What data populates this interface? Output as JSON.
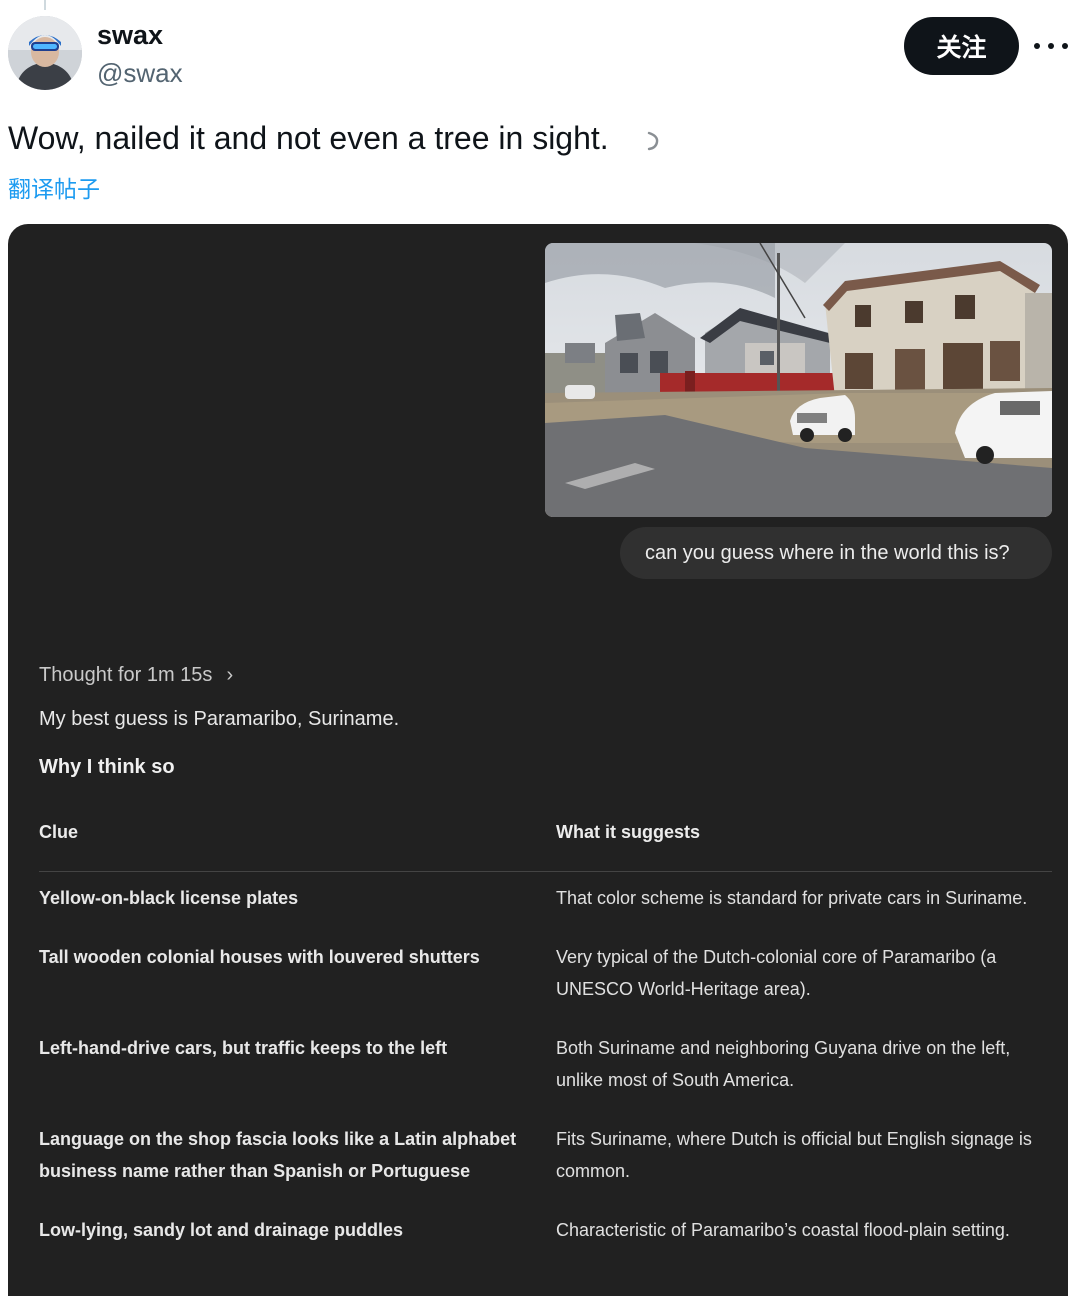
{
  "author": {
    "name": "swax",
    "handle": "@swax"
  },
  "follow_label": "关注",
  "more_icon": "more-horizontal-icon",
  "tweet": {
    "text": "Wow, nailed it and not even a tree in sight.",
    "translate_label": "翻译帖子"
  },
  "chat": {
    "user_prompt": "can you guess where in the world this is?",
    "thought_label": "Thought for 1m 15s",
    "answer": "My best guess is Paramaribo, Suriname.",
    "why_heading": "Why I think so",
    "table": {
      "headers": [
        "Clue",
        "What it suggests"
      ],
      "rows": [
        {
          "clue": "Yellow-on-black license plates",
          "suggests": "That color scheme is standard for private cars in Suriname."
        },
        {
          "clue": "Tall wooden colonial houses with louvered shutters",
          "suggests": "Very typical of the Dutch-colonial core of Paramaribo (a UNESCO World-Heritage area)."
        },
        {
          "clue": "Left-hand-drive cars, but traffic keeps to the left",
          "suggests": "Both Suriname and neighboring Guyana drive on the left, unlike most of South America."
        },
        {
          "clue": "Language on the shop fascia looks like a Latin alphabet business name rather than Spanish or Portuguese",
          "suggests": "Fits Suriname, where Dutch is official but English signage is common."
        },
        {
          "clue": "Low-lying, sandy lot and drainage puddles",
          "suggests": "Characteristic of Paramaribo’s coastal flood-plain setting."
        }
      ]
    }
  },
  "colors": {
    "card_bg": "#212121",
    "bubble_bg": "#303030",
    "link_blue": "#1d9bf0",
    "follow_bg": "#0f1419"
  }
}
